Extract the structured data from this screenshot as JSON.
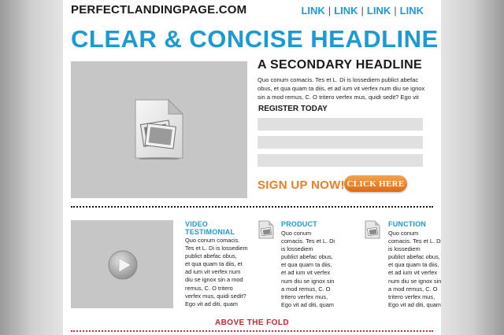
{
  "header": {
    "site_name": "PERFECTLANDINGPAGE.COM",
    "nav_links": [
      "LINK",
      "LINK",
      "LINK",
      "LINK"
    ]
  },
  "hero": {
    "headline": "CLEAR & CONCISE HEADLINE",
    "secondary_headline": "A SECONDARY HEADLINE",
    "body_lines": [
      "Quo conum comacis. Tes et L. Di is lossediem publict abefac",
      "obus, et qua quam ta diis, et ad ium vit verfex num diu se ignox",
      "sin a mod remus, C. O tritero verfex mus, quidi sedit? Ego vit"
    ],
    "register_label": "REGISTER TODAY",
    "signup_text": "SIGN UP NOW!",
    "cta_label": "CLICK HERE"
  },
  "columns": [
    {
      "title_lines": [
        "VIDEO",
        "TESTIMONIAL"
      ],
      "body_lines": [
        "Quo conum comacis.",
        "Tes et L. Di is lossediem",
        "publict abefac obus,",
        "et qua quam ta diis, et",
        "ad ium vit verfex num",
        "diu se ignox sin a mod",
        "remus, C. O tritero",
        "verfex mus, quidi sedit?",
        "Ego vit ad diti, quam"
      ]
    },
    {
      "title_lines": [
        "PRODUCT"
      ],
      "body_lines": [
        "Quo conum",
        "comacis. Tes et L. Di",
        "is lossediem",
        "publict abefac obus,",
        "et qua quam ta diis,",
        "et ad ium vit verfex",
        "num diu se ignox sin",
        "a mod remus, C. O",
        "tritero verfex mus,",
        "Ego vit ad diti, quam"
      ]
    },
    {
      "title_lines": [
        "FUNCTION"
      ],
      "body_lines": [
        "Quo conum",
        "comacis. Tes et L. Di",
        "is lossediem",
        "publict abefac obus,",
        "et qua quam ta diis,",
        "et ad ium vit verfex",
        "num diu se ignox sin",
        "a mod remus, C. O",
        "tritero verfex mus,",
        "Ego vit ad diti, quam"
      ]
    }
  ],
  "footer": {
    "fold_label": "ABOVE THE FOLD"
  },
  "colors": {
    "accent_blue": "#1c9ad6",
    "cta_orange": "#ef7d22",
    "fold_red": "#c62828",
    "placeholder_gray": "#c6c6c6"
  },
  "icons": {
    "hero": "image-document-icon",
    "video": "play-button-icon",
    "columns": "image-document-icon"
  }
}
